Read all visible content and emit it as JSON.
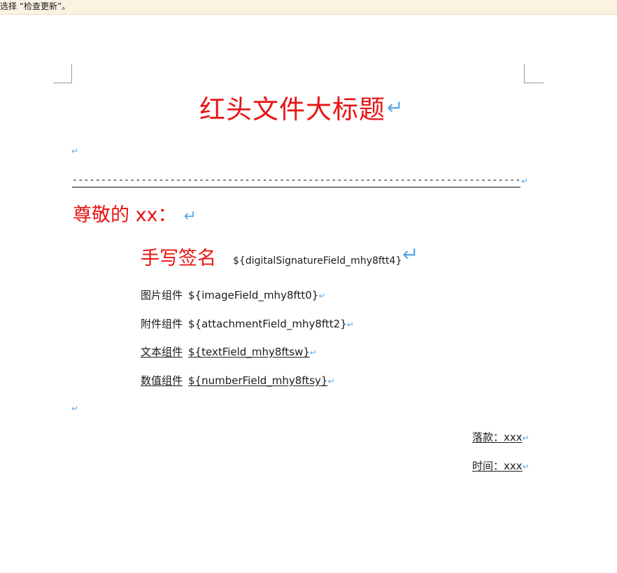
{
  "notice": {
    "text": "选择 “检查更新”。"
  },
  "document": {
    "paragraph_mark": "↵",
    "title": "红头文件大标题",
    "divider_dashes": "--------------------------------------------------------------------------------------------------------------",
    "greeting": "尊敬的 xx：",
    "signature": {
      "label": "手写签名",
      "field": "${digitalSignatureField_mhy8ftt4}"
    },
    "rows": [
      {
        "label": "图片组件",
        "field": "${imageField_mhy8ftt0}"
      },
      {
        "label": "附件组件",
        "field": "${attachmentField_mhy8ftt2}"
      },
      {
        "label": "文本组件",
        "field": "${textField_mhy8ftsw}"
      },
      {
        "label": "数值组件",
        "field": "${numberField_mhy8ftsy}"
      }
    ],
    "sign_off": [
      {
        "text": "落款：xxx"
      },
      {
        "text": "时间：xxx"
      }
    ]
  },
  "colors": {
    "heading_red": "#e81414",
    "paragraph_mark_blue": "#5aa9ea",
    "notice_bg": "#fbf3e2"
  }
}
